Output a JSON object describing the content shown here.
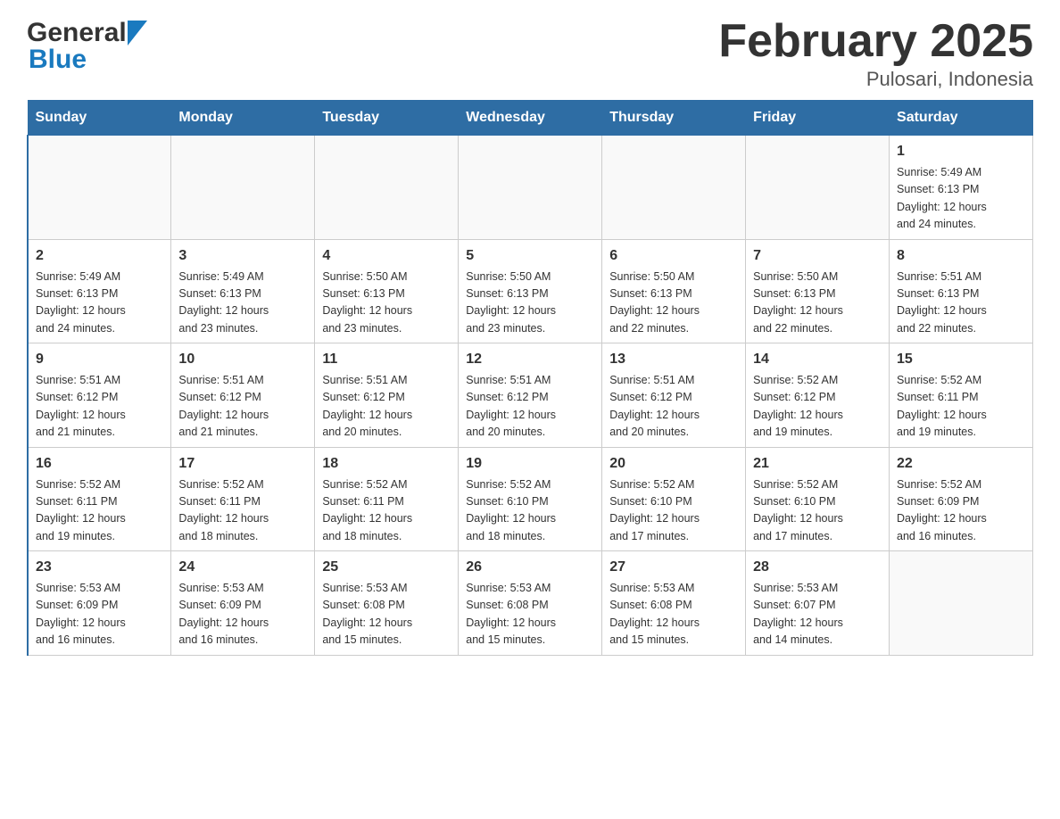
{
  "header": {
    "logo_general": "General",
    "logo_blue": "Blue",
    "month_year": "February 2025",
    "location": "Pulosari, Indonesia"
  },
  "calendar": {
    "days_of_week": [
      "Sunday",
      "Monday",
      "Tuesday",
      "Wednesday",
      "Thursday",
      "Friday",
      "Saturday"
    ],
    "weeks": [
      {
        "days": [
          {
            "date": "",
            "info": ""
          },
          {
            "date": "",
            "info": ""
          },
          {
            "date": "",
            "info": ""
          },
          {
            "date": "",
            "info": ""
          },
          {
            "date": "",
            "info": ""
          },
          {
            "date": "",
            "info": ""
          },
          {
            "date": "1",
            "info": "Sunrise: 5:49 AM\nSunset: 6:13 PM\nDaylight: 12 hours\nand 24 minutes."
          }
        ]
      },
      {
        "days": [
          {
            "date": "2",
            "info": "Sunrise: 5:49 AM\nSunset: 6:13 PM\nDaylight: 12 hours\nand 24 minutes."
          },
          {
            "date": "3",
            "info": "Sunrise: 5:49 AM\nSunset: 6:13 PM\nDaylight: 12 hours\nand 23 minutes."
          },
          {
            "date": "4",
            "info": "Sunrise: 5:50 AM\nSunset: 6:13 PM\nDaylight: 12 hours\nand 23 minutes."
          },
          {
            "date": "5",
            "info": "Sunrise: 5:50 AM\nSunset: 6:13 PM\nDaylight: 12 hours\nand 23 minutes."
          },
          {
            "date": "6",
            "info": "Sunrise: 5:50 AM\nSunset: 6:13 PM\nDaylight: 12 hours\nand 22 minutes."
          },
          {
            "date": "7",
            "info": "Sunrise: 5:50 AM\nSunset: 6:13 PM\nDaylight: 12 hours\nand 22 minutes."
          },
          {
            "date": "8",
            "info": "Sunrise: 5:51 AM\nSunset: 6:13 PM\nDaylight: 12 hours\nand 22 minutes."
          }
        ]
      },
      {
        "days": [
          {
            "date": "9",
            "info": "Sunrise: 5:51 AM\nSunset: 6:12 PM\nDaylight: 12 hours\nand 21 minutes."
          },
          {
            "date": "10",
            "info": "Sunrise: 5:51 AM\nSunset: 6:12 PM\nDaylight: 12 hours\nand 21 minutes."
          },
          {
            "date": "11",
            "info": "Sunrise: 5:51 AM\nSunset: 6:12 PM\nDaylight: 12 hours\nand 20 minutes."
          },
          {
            "date": "12",
            "info": "Sunrise: 5:51 AM\nSunset: 6:12 PM\nDaylight: 12 hours\nand 20 minutes."
          },
          {
            "date": "13",
            "info": "Sunrise: 5:51 AM\nSunset: 6:12 PM\nDaylight: 12 hours\nand 20 minutes."
          },
          {
            "date": "14",
            "info": "Sunrise: 5:52 AM\nSunset: 6:12 PM\nDaylight: 12 hours\nand 19 minutes."
          },
          {
            "date": "15",
            "info": "Sunrise: 5:52 AM\nSunset: 6:11 PM\nDaylight: 12 hours\nand 19 minutes."
          }
        ]
      },
      {
        "days": [
          {
            "date": "16",
            "info": "Sunrise: 5:52 AM\nSunset: 6:11 PM\nDaylight: 12 hours\nand 19 minutes."
          },
          {
            "date": "17",
            "info": "Sunrise: 5:52 AM\nSunset: 6:11 PM\nDaylight: 12 hours\nand 18 minutes."
          },
          {
            "date": "18",
            "info": "Sunrise: 5:52 AM\nSunset: 6:11 PM\nDaylight: 12 hours\nand 18 minutes."
          },
          {
            "date": "19",
            "info": "Sunrise: 5:52 AM\nSunset: 6:10 PM\nDaylight: 12 hours\nand 18 minutes."
          },
          {
            "date": "20",
            "info": "Sunrise: 5:52 AM\nSunset: 6:10 PM\nDaylight: 12 hours\nand 17 minutes."
          },
          {
            "date": "21",
            "info": "Sunrise: 5:52 AM\nSunset: 6:10 PM\nDaylight: 12 hours\nand 17 minutes."
          },
          {
            "date": "22",
            "info": "Sunrise: 5:52 AM\nSunset: 6:09 PM\nDaylight: 12 hours\nand 16 minutes."
          }
        ]
      },
      {
        "days": [
          {
            "date": "23",
            "info": "Sunrise: 5:53 AM\nSunset: 6:09 PM\nDaylight: 12 hours\nand 16 minutes."
          },
          {
            "date": "24",
            "info": "Sunrise: 5:53 AM\nSunset: 6:09 PM\nDaylight: 12 hours\nand 16 minutes."
          },
          {
            "date": "25",
            "info": "Sunrise: 5:53 AM\nSunset: 6:08 PM\nDaylight: 12 hours\nand 15 minutes."
          },
          {
            "date": "26",
            "info": "Sunrise: 5:53 AM\nSunset: 6:08 PM\nDaylight: 12 hours\nand 15 minutes."
          },
          {
            "date": "27",
            "info": "Sunrise: 5:53 AM\nSunset: 6:08 PM\nDaylight: 12 hours\nand 15 minutes."
          },
          {
            "date": "28",
            "info": "Sunrise: 5:53 AM\nSunset: 6:07 PM\nDaylight: 12 hours\nand 14 minutes."
          },
          {
            "date": "",
            "info": ""
          }
        ]
      }
    ]
  }
}
